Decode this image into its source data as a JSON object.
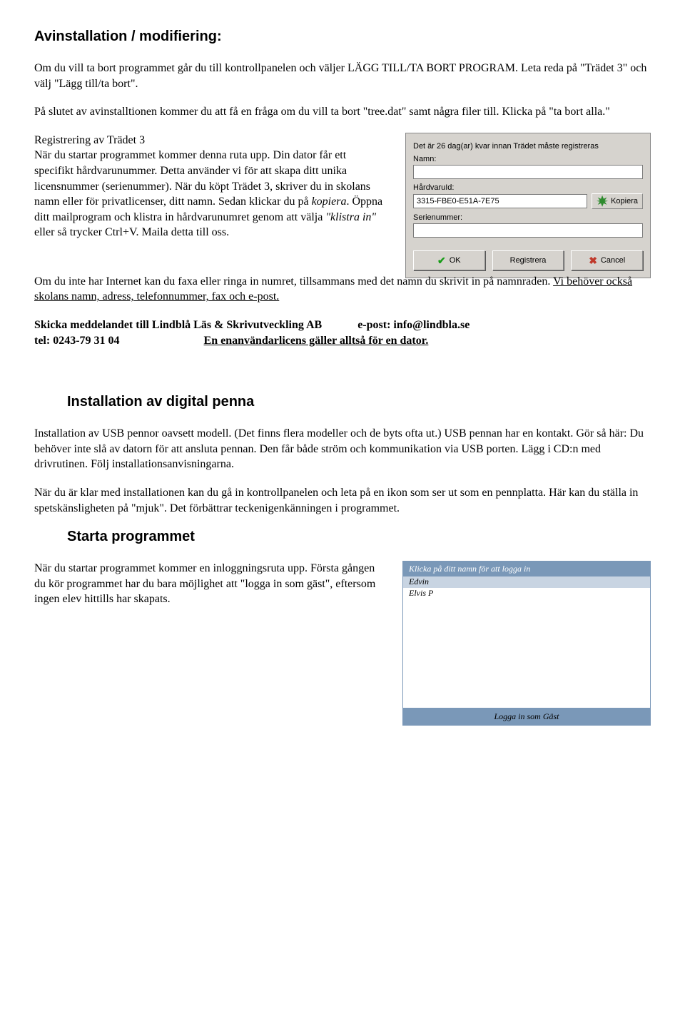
{
  "sec1": {
    "title": "Avinstallation / modifiering:",
    "p1": "Om du vill ta bort programmet går du till kontrollpanelen och väljer LÄGG TILL/TA BORT PROGRAM. Leta reda på \"Trädet 3\" och välj \"Lägg till/ta bort\".",
    "p2": "På slutet av avinstalltionen kommer du att få en fråga om du vill ta bort \"tree.dat\" samt några filer till. Klicka på \"ta bort alla.\""
  },
  "sec2": {
    "title": "Registrering av Trädet 3",
    "p1a": "När du startar programmet kommer denna ruta upp. Din dator får ett specifikt hårdvarunummer. Detta använder vi för att skapa ditt unika licensnummer (serienummer). När du köpt  Trädet 3, skriver du in skolans namn eller för privatlicenser, ditt namn. Sedan klickar du på ",
    "p1b_italic": "kopiera",
    "p1c": ". Öppna ditt mailprogram och  klistra in hårdvarunumret genom att välja ",
    "p1d_italic": "\"klistra in\"",
    "p1e": " eller så trycker Ctrl+V. Maila detta till oss.",
    "p2a": "Om du inte har Internet kan du faxa eller ringa in numret, tillsammans med det namn du skrivit in på namnraden. ",
    "p2b_ul": "Vi behöver också skolans namn, adress, telefonnummer, fax och e-post.",
    "p3_bold_a": "Skicka meddelandet till Lindblå Läs & Skrivutveckling  AB",
    "p3_bold_b": "e-post: info@lindbla.se",
    "p4_bold_a": "tel: 0243-79 31 04",
    "p4_bold_b_ul": "En enanvändarlicens gäller alltså för en dator."
  },
  "regdlg": {
    "days_text": "Det är 26 dag(ar) kvar innan Trädet måste registreras",
    "lbl_name": "Namn:",
    "lbl_hw": "HårdvaruId:",
    "hw_value": "3315-FBE0-E51A-7E75",
    "kopiera": "Kopiera",
    "lbl_serial": "Serienummer:",
    "btn_ok": "OK",
    "btn_reg": "Registrera",
    "btn_cancel": "Cancel"
  },
  "sec3": {
    "title": "Installation av digital penna",
    "p1": "Installation av USB pennor oavsett modell. (Det finns flera modeller och de byts ofta ut.) USB pennan har en kontakt. Gör så här: Du behöver inte slå av datorn för att ansluta pennan. Den får både ström och kommunikation via USB porten. Lägg i CD:n med drivrutinen. Följ installationsanvisningarna.",
    "p2": "När du är klar med installationen kan du gå in kontrollpanelen och leta på en ikon som ser ut som en pennplatta. Här kan du ställa in spetskänsligheten på \"mjuk\". Det förbättrar teckenigenkänningen i programmet."
  },
  "sec4": {
    "title": "Starta programmet",
    "p1": "När du startar programmet kommer en inloggningsruta upp. Första gången du kör programmet har du bara möjlighet att \"logga in som gäst\", eftersom ingen elev hittills har skapats."
  },
  "login": {
    "title": "Klicka på ditt namn för att logga in",
    "items": [
      "Edvin",
      "Elvis P"
    ],
    "footer": "Logga  in  som  Gäst"
  }
}
